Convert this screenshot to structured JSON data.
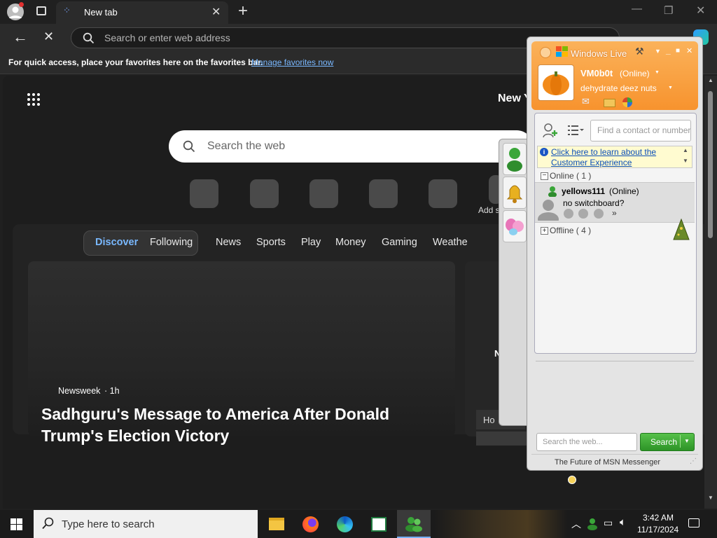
{
  "browser": {
    "tab_title": "New tab",
    "address_placeholder": "Search or enter web address",
    "favorites_hint": "For quick access, place your favorites here on the favorites bar.",
    "favorites_link": "Manage favorites now"
  },
  "ntp": {
    "greeting": "New Y",
    "search_placeholder": "Search the web",
    "quick_add_label": "Add s",
    "feed_tabs": [
      "Discover",
      "Following"
    ],
    "feed_nav": [
      "News",
      "Sports",
      "Play",
      "Money",
      "Gaming",
      "Weathe"
    ],
    "card_source": "Newsweek",
    "card_age": "· 1h",
    "card_title": "Sadhguru's Message to America After Donald Trump's Election Victory",
    "side_card_label": "Ho",
    "side_card_tag": "N"
  },
  "msn": {
    "title": "Windows Live",
    "user_name": "VM0b0t",
    "user_status": "(Online)",
    "personal_message": "dehydrate deez nuts",
    "find_placeholder": "Find a contact or number",
    "info_link": "Click here to learn about the Customer Experience",
    "online_group": "Online ( 1 )",
    "contact_name": "yellows111",
    "contact_status": "(Online)",
    "contact_message": "no switchboard?",
    "offline_group": "Offline ( 4 )",
    "search_placeholder": "Search the web...",
    "search_button": "Search",
    "footer": "The Future of MSN Messenger"
  },
  "taskbar": {
    "search_placeholder": "Type here to search",
    "time": "3:42 AM",
    "date": "11/17/2024"
  },
  "colors": {
    "accent_blue": "#79b8ff",
    "msn_orange": "#f7932e",
    "msn_green": "#3aa639"
  }
}
